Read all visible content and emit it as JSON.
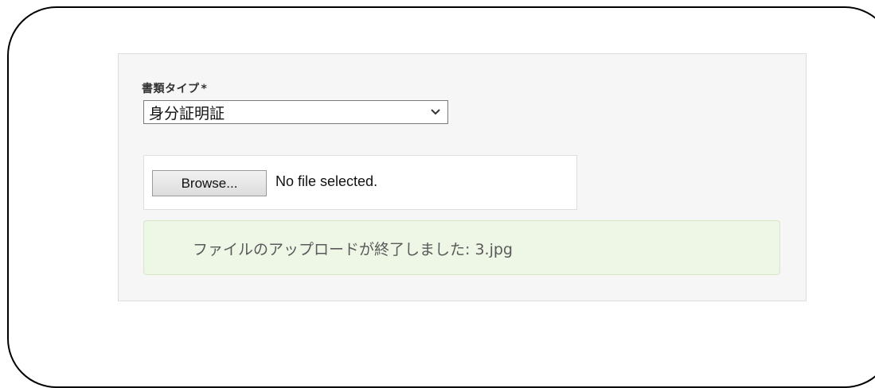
{
  "form": {
    "document_type_label": "書類タイプ",
    "required_mark": "*",
    "document_type_value": "身分証明証"
  },
  "file_input": {
    "browse_label": "Browse...",
    "status": "No file selected."
  },
  "alert": {
    "message": "ファイルのアップロードが終了しました: 3.jpg"
  },
  "colors": {
    "panel_bg": "#f6f6f6",
    "success_bg": "#eef6e6",
    "success_border": "#d6e7c8"
  }
}
